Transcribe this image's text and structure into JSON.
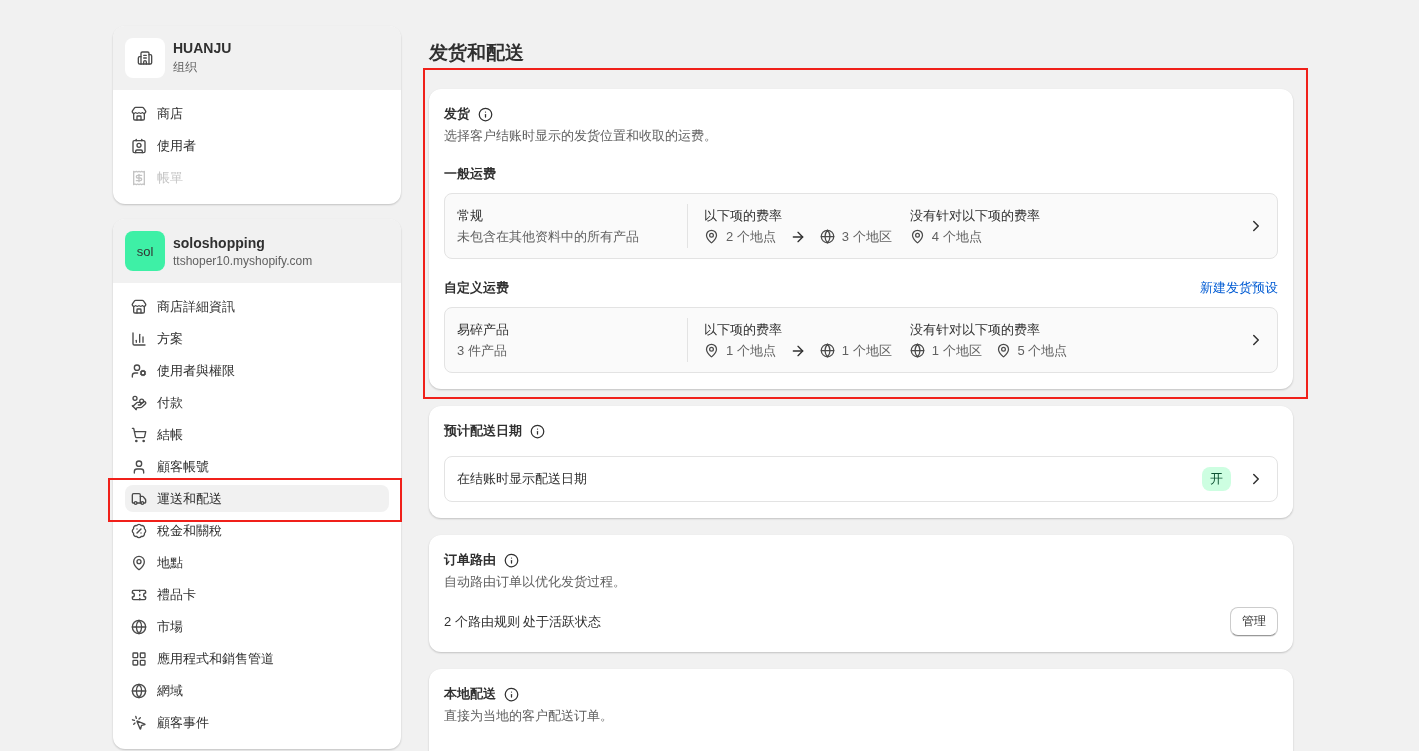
{
  "org": {
    "name": "HUANJU",
    "subtitle": "组织",
    "items": [
      {
        "label": "商店",
        "disabled": false
      },
      {
        "label": "使用者",
        "disabled": false
      },
      {
        "label": "帳單",
        "disabled": true
      }
    ]
  },
  "store": {
    "avatar": "sol",
    "name": "soloshopping",
    "domain": "ttshoper10.myshopify.com",
    "items": [
      {
        "label": "商店詳細資訊",
        "selected": false
      },
      {
        "label": "方案",
        "selected": false
      },
      {
        "label": "使用者與權限",
        "selected": false
      },
      {
        "label": "付款",
        "selected": false
      },
      {
        "label": "結帳",
        "selected": false
      },
      {
        "label": "顧客帳號",
        "selected": false
      },
      {
        "label": "運送和配送",
        "selected": true
      },
      {
        "label": "稅金和關稅",
        "selected": false
      },
      {
        "label": "地點",
        "selected": false
      },
      {
        "label": "禮品卡",
        "selected": false
      },
      {
        "label": "市場",
        "selected": false
      },
      {
        "label": "應用程式和銷售管道",
        "selected": false
      },
      {
        "label": "網域",
        "selected": false
      },
      {
        "label": "顧客事件",
        "selected": false
      }
    ]
  },
  "page_title": "发货和配送",
  "shipping": {
    "title": "发货",
    "description": "选择客户结账时显示的发货位置和收取的运费。",
    "general": {
      "heading": "一般运费",
      "profiles": [
        {
          "name": "常规",
          "subtitle": "未包含在其他资料中的所有产品",
          "rates_label": "以下项的费率",
          "from": [
            {
              "kind": "pin",
              "text": "2 个地点"
            }
          ],
          "to": [
            {
              "kind": "globe",
              "text": "3 个地区"
            }
          ],
          "none_label": "没有针对以下项的费率",
          "none": [
            {
              "kind": "pin",
              "text": "4 个地点"
            }
          ]
        }
      ]
    },
    "custom": {
      "heading": "自定义运费",
      "link": "新建发货预设",
      "profiles": [
        {
          "name": "易碎产品",
          "subtitle": "3 件产品",
          "rates_label": "以下项的费率",
          "from": [
            {
              "kind": "pin",
              "text": "1 个地点"
            }
          ],
          "to": [
            {
              "kind": "globe",
              "text": "1 个地区"
            }
          ],
          "none_label": "没有针对以下项的费率",
          "none": [
            {
              "kind": "globe",
              "text": "1 个地区"
            },
            {
              "kind": "pin",
              "text": "5 个地点"
            }
          ]
        }
      ]
    }
  },
  "delivery_dates": {
    "title": "预计配送日期",
    "row_label": "在结账时显示配送日期",
    "status": "开",
    "on": true
  },
  "order_routing": {
    "title": "订单路由",
    "description": "自动路由订单以优化发货过程。",
    "summary": "2 个路由规则 处于活跃状态",
    "button": "管理"
  },
  "local_delivery": {
    "title": "本地配送",
    "description": "直接为当地的客户配送订单。"
  }
}
